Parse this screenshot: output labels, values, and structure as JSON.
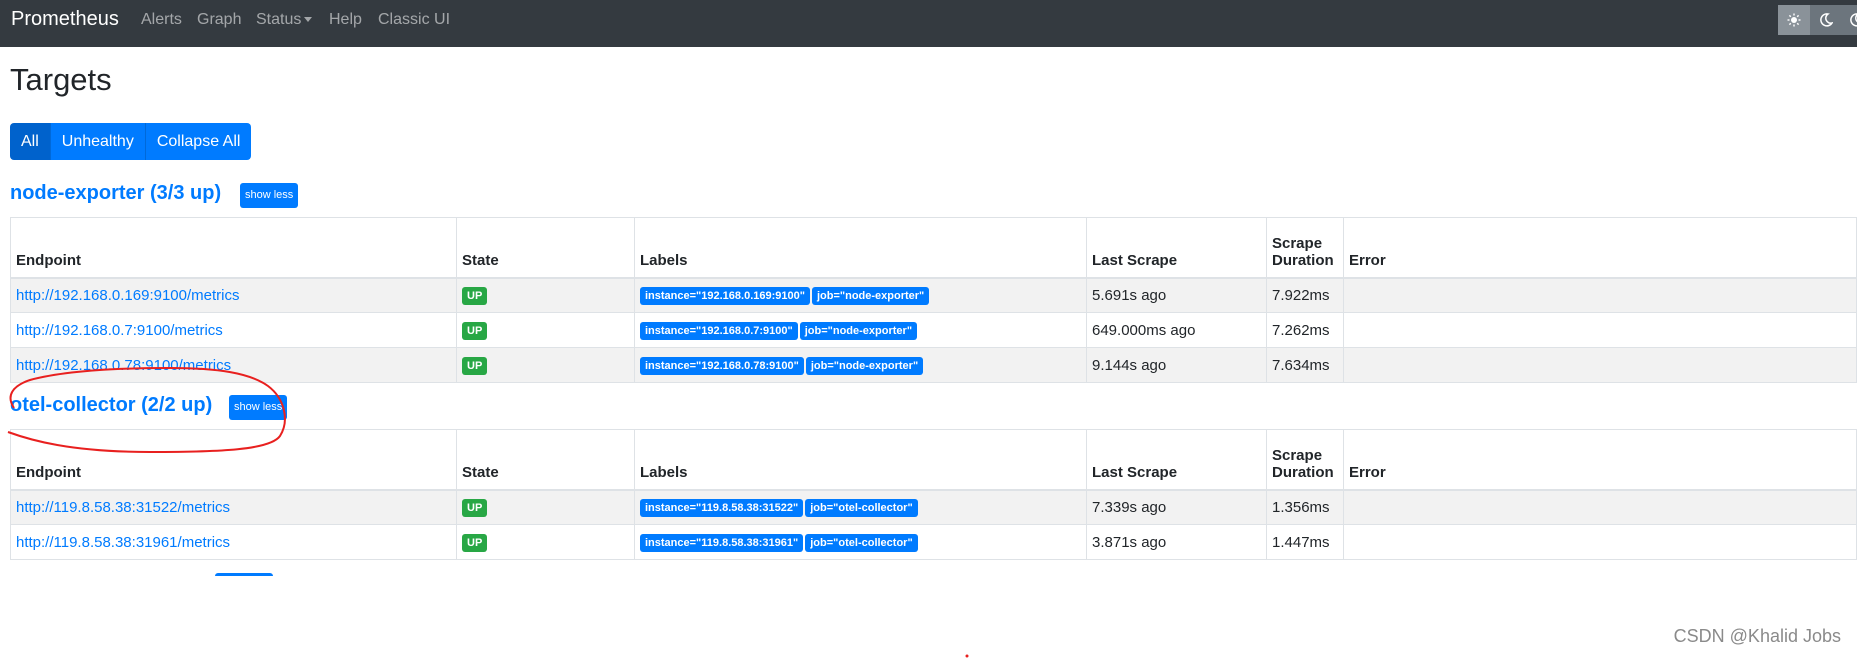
{
  "navbar": {
    "brand": "Prometheus",
    "items": [
      "Alerts",
      "Graph",
      "Status",
      "Help",
      "Classic UI"
    ],
    "theme_icons": [
      "sun-icon",
      "moon-icon",
      "moon-icon"
    ]
  },
  "page": {
    "title": "Targets",
    "filters": [
      "All",
      "Unhealthy",
      "Collapse All"
    ]
  },
  "table_headers": {
    "endpoint": "Endpoint",
    "state": "State",
    "labels": "Labels",
    "last_scrape": "Last Scrape",
    "scrape_duration_1": "Scrape",
    "scrape_duration_2": "Duration",
    "error": "Error"
  },
  "jobs": [
    {
      "title": "node-exporter (3/3 up)",
      "toggle": "show less",
      "rows": [
        {
          "endpoint": "http://192.168.0.169:9100/metrics",
          "state": "UP",
          "labels": [
            "instance=\"192.168.0.169:9100\"",
            "job=\"node-exporter\""
          ],
          "last_scrape": "5.691s ago",
          "duration": "7.922ms",
          "error": ""
        },
        {
          "endpoint": "http://192.168.0.7:9100/metrics",
          "state": "UP",
          "labels": [
            "instance=\"192.168.0.7:9100\"",
            "job=\"node-exporter\""
          ],
          "last_scrape": "649.000ms ago",
          "duration": "7.262ms",
          "error": ""
        },
        {
          "endpoint": "http://192.168.0.78:9100/metrics",
          "state": "UP",
          "labels": [
            "instance=\"192.168.0.78:9100\"",
            "job=\"node-exporter\""
          ],
          "last_scrape": "9.144s ago",
          "duration": "7.634ms",
          "error": ""
        }
      ]
    },
    {
      "title": "otel-collector (2/2 up)",
      "toggle": "show less",
      "rows": [
        {
          "endpoint": "http://119.8.58.38:31522/metrics",
          "state": "UP",
          "labels": [
            "instance=\"119.8.58.38:31522\"",
            "job=\"otel-collector\""
          ],
          "last_scrape": "7.339s ago",
          "duration": "1.356ms",
          "error": ""
        },
        {
          "endpoint": "http://119.8.58.38:31961/metrics",
          "state": "UP",
          "labels": [
            "instance=\"119.8.58.38:31961\"",
            "job=\"otel-collector\""
          ],
          "last_scrape": "3.871s ago",
          "duration": "1.447ms",
          "error": ""
        }
      ]
    }
  ],
  "watermark": "CSDN @Khalid Jobs",
  "colors": {
    "navbar": "#343a40",
    "primary": "#007bff",
    "success": "#28a745",
    "annotation": "#e8201f"
  }
}
